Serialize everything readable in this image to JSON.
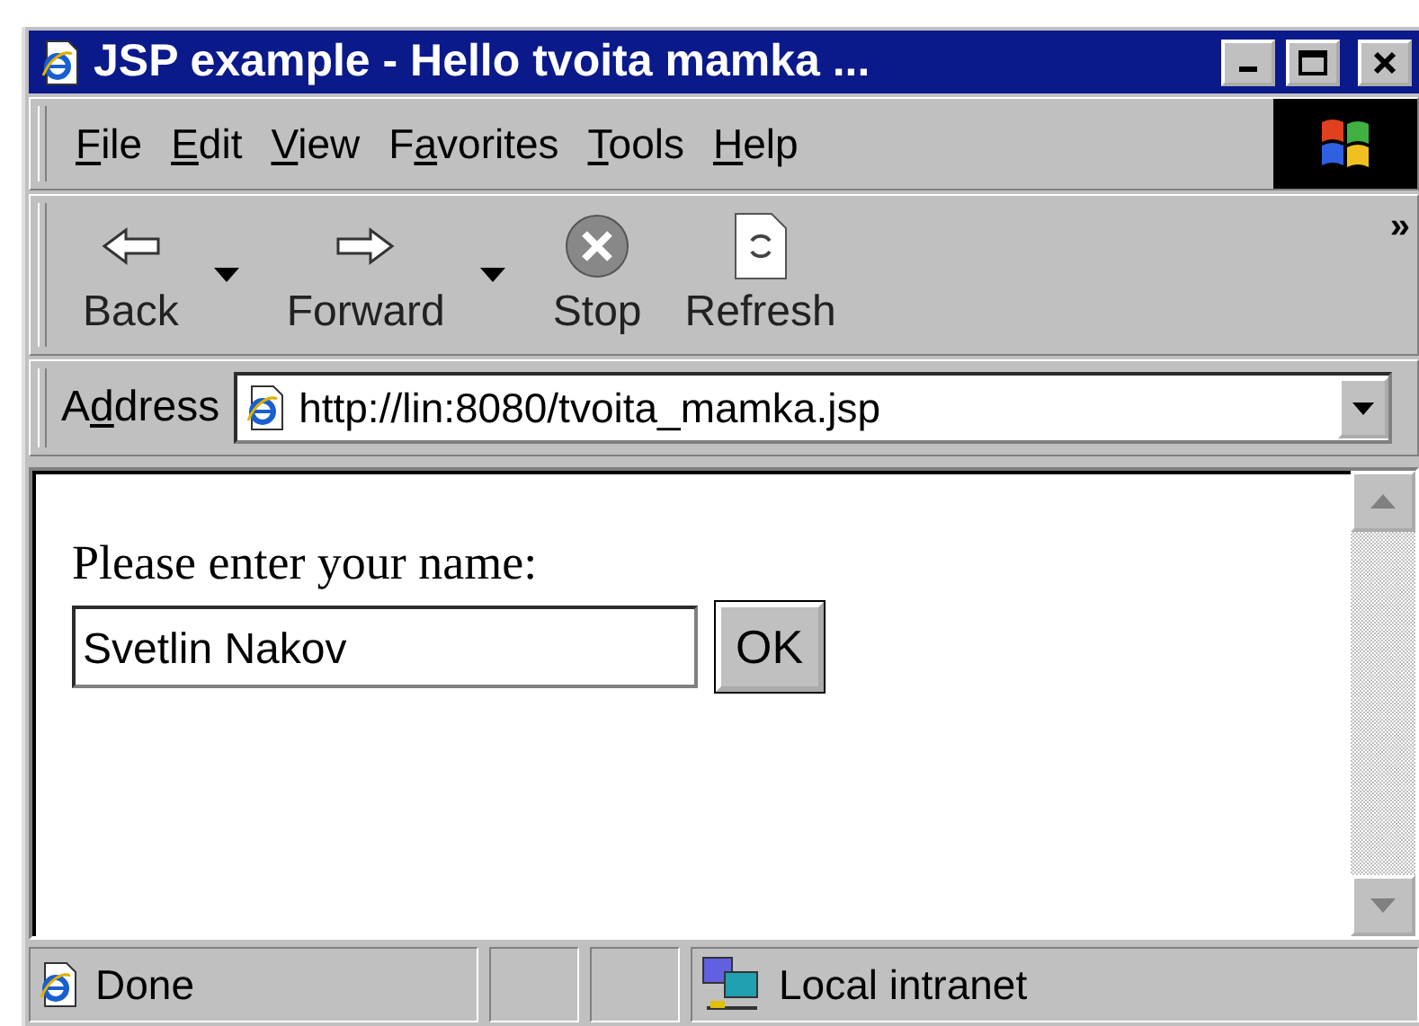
{
  "window": {
    "title": "JSP example - Hello tvoita mamka ..."
  },
  "menu": [
    {
      "access_key": "F",
      "after": "ile"
    },
    {
      "access_key": "E",
      "after": "dit"
    },
    {
      "access_key": "V",
      "after": "iew"
    },
    {
      "before": "F",
      "access_key": "a",
      "after": "vorites"
    },
    {
      "access_key": "T",
      "after": "ools"
    },
    {
      "access_key": "H",
      "after": "elp"
    }
  ],
  "toolbar": {
    "buttons": [
      {
        "label": "Back",
        "kind": "back",
        "dropdown": true
      },
      {
        "label": "Forward",
        "kind": "forward",
        "dropdown": true
      },
      {
        "label": "Stop",
        "kind": "stop",
        "dropdown": false
      },
      {
        "label": "Refresh",
        "kind": "refresh",
        "dropdown": false
      }
    ],
    "overflow": "»"
  },
  "address": {
    "label": {
      "before": "A",
      "access_key": "d",
      "after": "dress"
    },
    "value": "http://lin:8080/tvoita_mamka.jsp"
  },
  "page": {
    "prompt": "Please enter your name:",
    "name_field": {
      "value": "Svetlin Nakov"
    },
    "ok_button": "OK"
  },
  "status_bar": {
    "text": "Done",
    "zone": "Local intranet"
  }
}
